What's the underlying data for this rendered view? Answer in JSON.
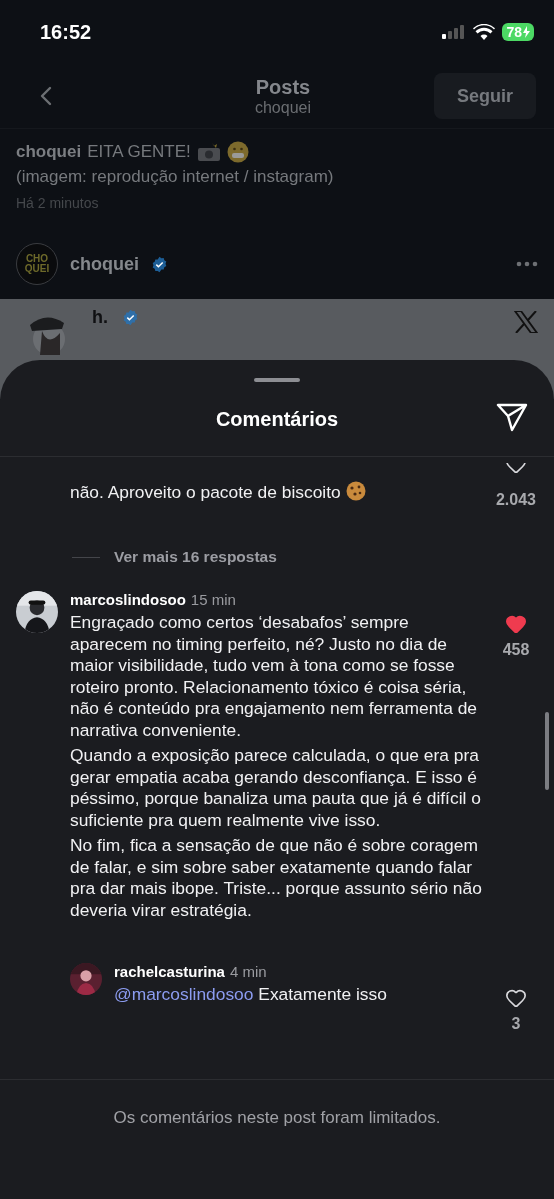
{
  "status_bar": {
    "time": "16:52",
    "battery": "78",
    "charging": true
  },
  "header": {
    "title": "Posts",
    "subtitle": "choquei",
    "follow_button": "Seguir"
  },
  "caption": {
    "author": "choquei",
    "text": "EITA GENTE!",
    "line2": "(imagem: reprodução internet / instagram)",
    "time": "Há 2 minutos"
  },
  "post": {
    "author": "choquei",
    "verified": true,
    "avatar_lines": [
      "CHO",
      "QUEI"
    ]
  },
  "embed": {
    "author": "h.",
    "verified": true
  },
  "sheet": {
    "title": "Comentários"
  },
  "comments": [
    {
      "kind": "partial",
      "text": "não. Aproveito o pacote de biscoito",
      "liked": false,
      "likes": "2.043"
    },
    {
      "kind": "more",
      "text": "Ver mais 16 respostas"
    },
    {
      "kind": "comment",
      "reply": false,
      "user": "marcoslindosoo",
      "time": "15 min",
      "paragraphs": [
        "Engraçado como certos ‘desabafos’ sempre aparecem no timing perfeito, né? Justo no dia de maior visibilidade, tudo vem à tona como se fosse roteiro pronto. Relacionamento tóxico é coisa séria, não é conteúdo pra engajamento nem ferramenta de narrativa conveniente.",
        "Quando a exposição parece calculada, o que era pra gerar empatia acaba gerando desconfiança. E isso é péssimo, porque banaliza uma pauta que já é difícil o suficiente pra quem realmente vive isso.",
        "No fim, fica a sensação de que não é sobre coragem de falar, e sim sobre saber exatamente quando falar pra dar mais ibope. Triste... porque assunto sério não deveria virar estratégia."
      ],
      "liked": true,
      "likes": "458"
    },
    {
      "kind": "comment",
      "reply": true,
      "user": "rachelcasturina",
      "time": "4 min",
      "mention": "@marcoslindosoo",
      "paragraphs": [
        "Exatamente isso"
      ],
      "liked": false,
      "likes": "3"
    }
  ],
  "footer": "Os comentários neste post foram limitados."
}
